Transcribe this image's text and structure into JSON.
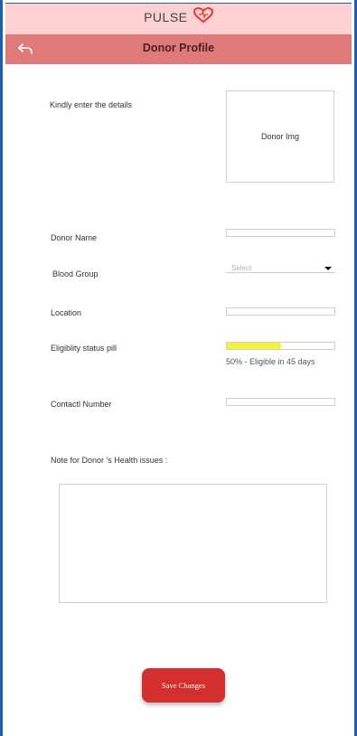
{
  "app": {
    "brand": "PULSE",
    "title": "Donor Profile"
  },
  "intro": {
    "text": "Kindly enter the details"
  },
  "photo": {
    "placeholder": "Donor Img"
  },
  "form": {
    "donor_name_label": "Donor Name",
    "blood_group_label": "Blood Group",
    "blood_group_value": "Select",
    "location_label": "Location",
    "eligibility_label": "Eligiblity status pill",
    "eligibility_percent": 50,
    "eligibility_text": "50% - Eligible in 45 days",
    "contact_label": "Contactl Number",
    "notes_label": "Note for Donor 's Health issues :"
  },
  "actions": {
    "save_label": "Save Changes"
  },
  "colors": {
    "brand_bar": "#fdd1d1",
    "title_bar": "#e07a7a",
    "primary": "#d32f2f",
    "progress": "#f6f23c",
    "frame": "#1f5fb2"
  },
  "icons": {
    "back": "back-arrow-icon",
    "logo": "heart-logo-icon",
    "dropdown": "caret-down-icon"
  }
}
